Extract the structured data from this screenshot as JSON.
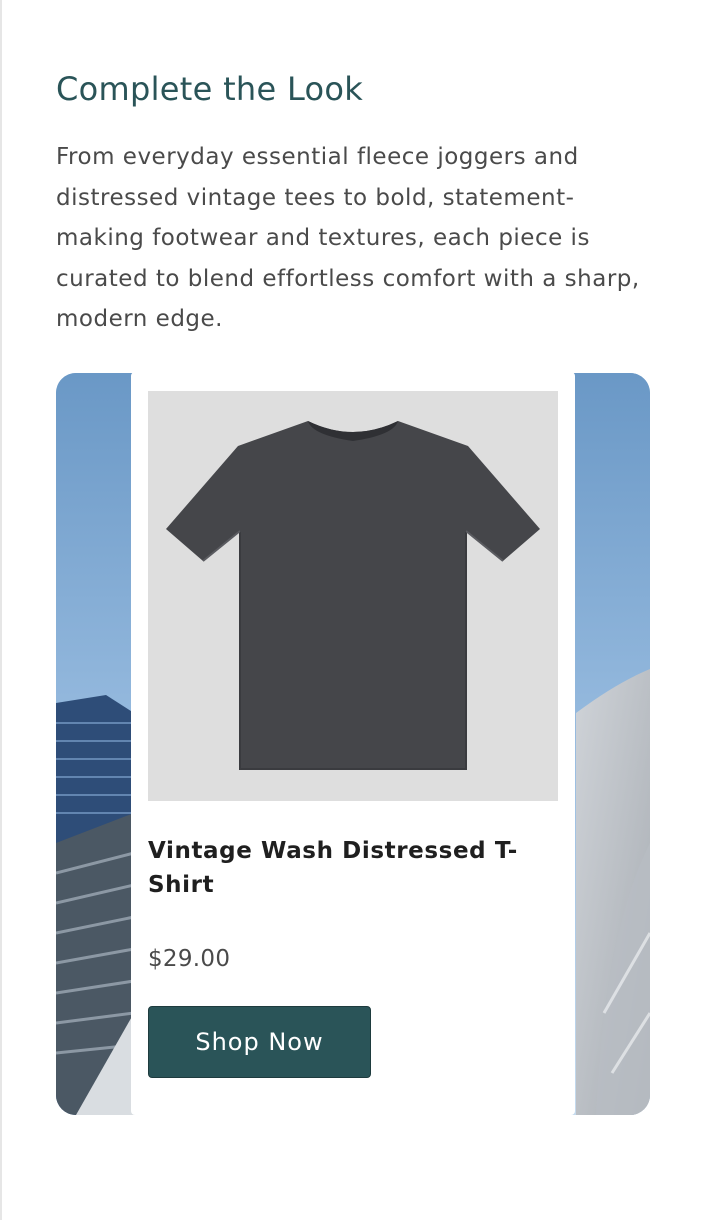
{
  "section": {
    "heading": "Complete the Look",
    "description": "From everyday essential fleece joggers and distressed vintage tees to bold, statement-making footwear and textures, each piece is curated to blend effortless comfort with a sharp, modern edge."
  },
  "product": {
    "title": "Vintage Wash Distressed T-Shirt",
    "price": "$29.00",
    "cta_label": "Shop Now"
  },
  "colors": {
    "heading": "#2a5458",
    "button_bg": "#2a5458",
    "body_text": "#4a4a4a",
    "shirt": "#45464a"
  }
}
